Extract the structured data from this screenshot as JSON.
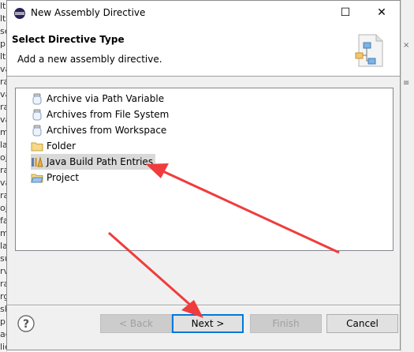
{
  "window": {
    "title": "New Assembly Directive",
    "maximize_glyph": "☐",
    "close_glyph": "✕"
  },
  "banner": {
    "title": "Select Directive Type",
    "description": "Add a new assembly directive."
  },
  "list": {
    "items": [
      {
        "label": "Archive via Path Variable",
        "icon": "jar-icon",
        "selected": false
      },
      {
        "label": "Archives from File System",
        "icon": "jar-icon",
        "selected": false
      },
      {
        "label": "Archives from Workspace",
        "icon": "jar-icon",
        "selected": false
      },
      {
        "label": "Folder",
        "icon": "folder-icon",
        "selected": false
      },
      {
        "label": "Java Build Path Entries",
        "icon": "library-icon",
        "selected": true
      },
      {
        "label": "Project",
        "icon": "project-folder-icon",
        "selected": false
      }
    ]
  },
  "buttons": {
    "help": "?",
    "back": "< Back",
    "next": "Next >",
    "finish": "Finish",
    "cancel": "Cancel"
  },
  "background_fragments": {
    "left": [
      "lt",
      "lt",
      "se",
      "p",
      "lt",
      "va",
      "ra",
      "va",
      "ra",
      "va",
      "m",
      "la",
      "oj",
      "ra",
      "va",
      "ra",
      "oj",
      "fa",
      "m",
      "la",
      "su",
      "rv",
      "ra",
      "rg",
      "sk",
      "pr",
      "ac",
      "sk",
      "lication"
    ],
    "right": [
      "×",
      "≡"
    ]
  },
  "colors": {
    "accent": "#0078d7",
    "selection": "#d9d9d9",
    "annotation_arrow": "#f03c3c"
  }
}
